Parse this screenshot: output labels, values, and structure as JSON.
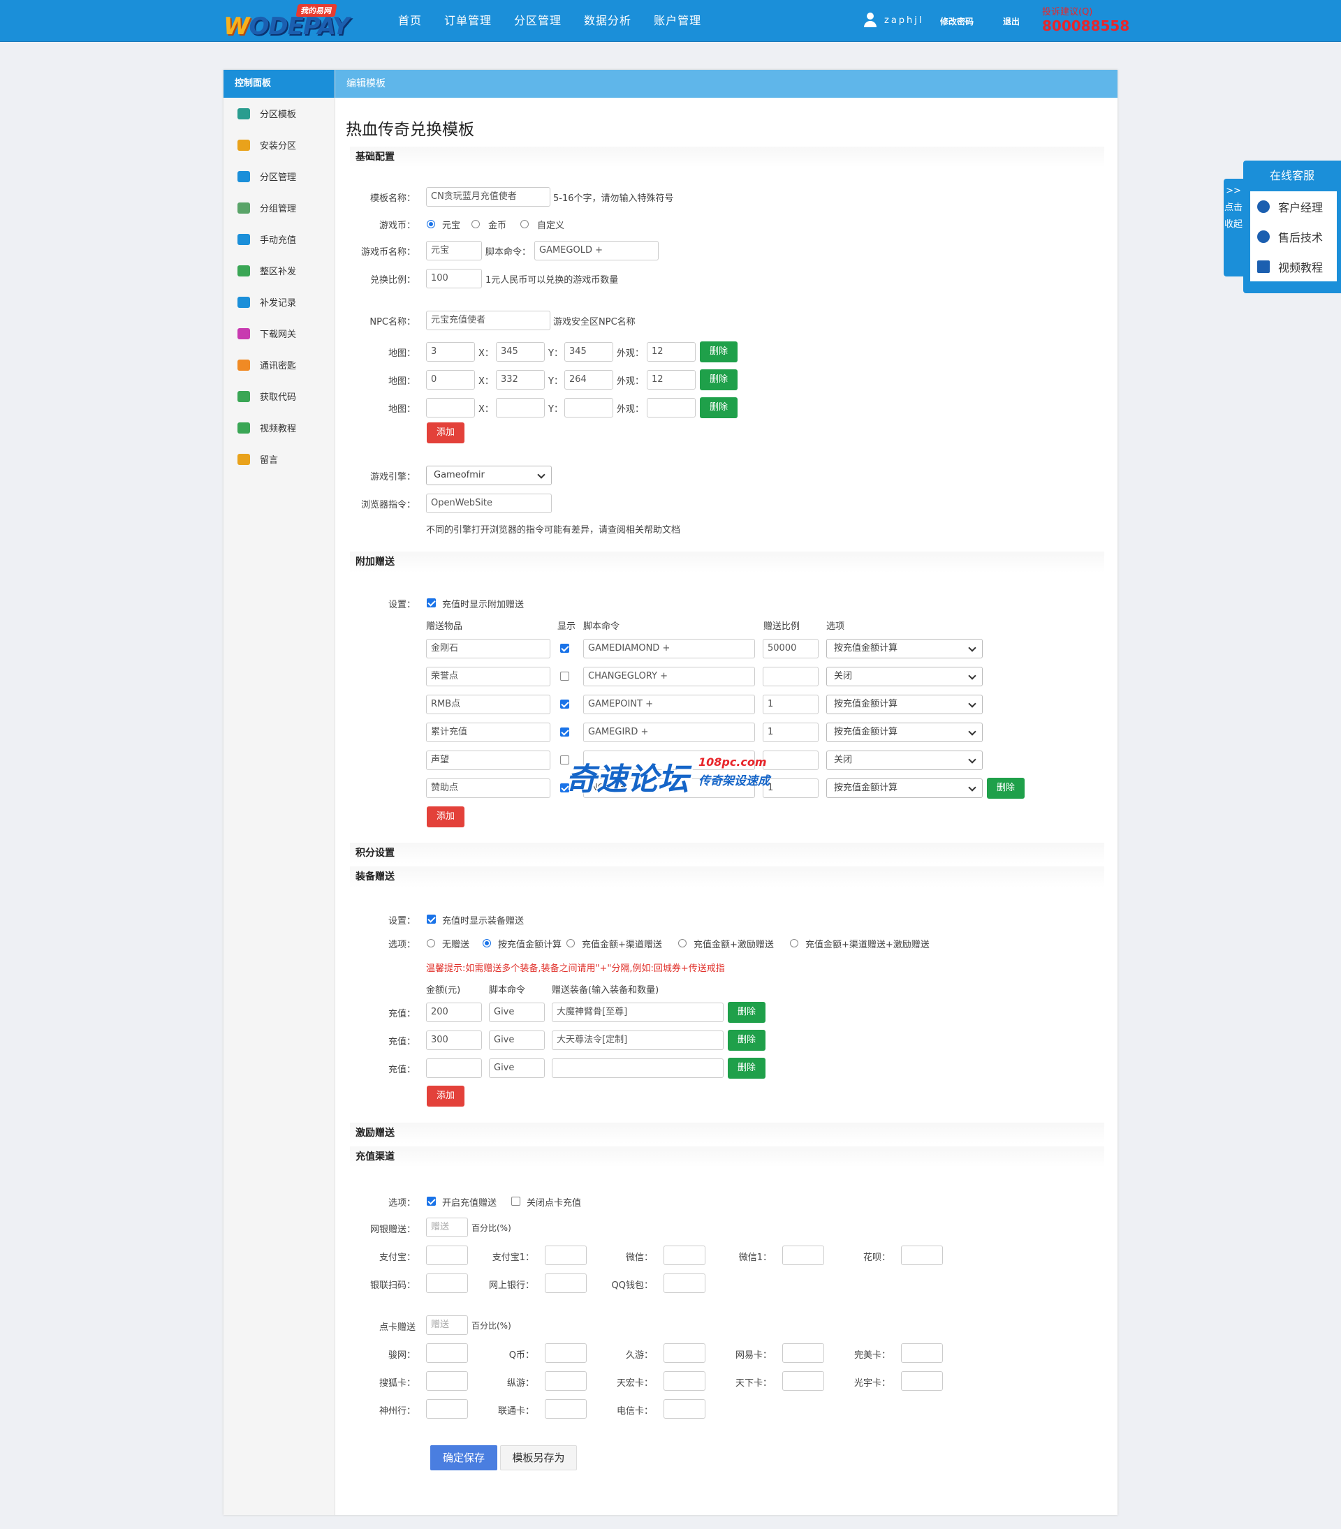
{
  "header": {
    "logo_tag": "我的易网",
    "logo_text_a": "W",
    "logo_text_b": "ODEPAY",
    "nav": [
      "首页",
      "订单管理",
      "分区管理",
      "数据分析",
      "账户管理"
    ],
    "username": "zaphjl",
    "change_pwd": "修改密码",
    "logout": "退出",
    "hotline_label": "投诉建议(Q)",
    "hotline_number": "800088558"
  },
  "sidebar": {
    "title": "控制面板",
    "items": [
      "分区模板",
      "安装分区",
      "分区管理",
      "分组管理",
      "手动充值",
      "整区补发",
      "补发记录",
      "下载网关",
      "通讯密匙",
      "获取代码",
      "视频教程",
      "留言"
    ],
    "icon_colors": [
      "#2a9d8f",
      "#e9a21b",
      "#1b8fd9",
      "#5aa469",
      "#1b8fd9",
      "#3aa655",
      "#1b8fd9",
      "#c83ab0",
      "#f08a24",
      "#3aa655",
      "#3aa655",
      "#e9a21b"
    ]
  },
  "main": {
    "header": "编辑模板",
    "title": "热血传奇兑换模板"
  },
  "basic": {
    "section": "基础配置",
    "name_label": "模板名称：",
    "name_value": "CN贪玩蓝月充值使者",
    "name_hint": "5-16个字，请勿输入特殊符号",
    "currency_label": "游戏币：",
    "currency_options": [
      "元宝",
      "金币",
      "自定义"
    ],
    "currency_name_label": "游戏币名称：",
    "currency_name_value": "元宝",
    "script_label": "脚本命令：",
    "script_value": "GAMEGOLD +",
    "ratio_label": "兑换比例：",
    "ratio_value": "100",
    "ratio_hint": "1元人民币可以兑换的游戏币数量",
    "npc_label": "NPC名称：",
    "npc_value": "元宝充值使者",
    "npc_hint": "游戏安全区NPC名称",
    "map_label": "地图：",
    "x_label": "X：",
    "y_label": "Y：",
    "look_label": "外观：",
    "maps": [
      {
        "map": "3",
        "x": "345",
        "y": "345",
        "look": "12"
      },
      {
        "map": "0",
        "x": "332",
        "y": "264",
        "look": "12"
      },
      {
        "map": "",
        "x": "",
        "y": "",
        "look": ""
      }
    ],
    "delete": "删除",
    "add": "添加",
    "engine_label": "游戏引擎：",
    "engine_value": "Gameofmir",
    "browser_label": "浏览器指令：",
    "browser_value": "OpenWebSite",
    "browser_hint": "不同的引擎打开浏览器的指令可能有差异，请查阅相关帮助文档"
  },
  "extra": {
    "section": "附加赠送",
    "setting_label": "设置：",
    "setting_text": "充值时显示附加赠送",
    "headers": [
      "赠送物品",
      "显示",
      "脚本命令",
      "赠送比例",
      "选项"
    ],
    "rows": [
      {
        "item": "金刚石",
        "show": true,
        "cmd": "GAMEDIAMOND +",
        "ratio": "50000",
        "opt": "按充值金额计算"
      },
      {
        "item": "荣誉点",
        "show": false,
        "cmd": "CHANGEGLORY +",
        "ratio": "",
        "opt": "关闭"
      },
      {
        "item": "RMB点",
        "show": true,
        "cmd": "GAMEPOINT +",
        "ratio": "1",
        "opt": "按充值金额计算"
      },
      {
        "item": "累计充值",
        "show": true,
        "cmd": "GAMEGIRD +",
        "ratio": "1",
        "opt": "按充值金额计算"
      },
      {
        "item": "声望",
        "show": false,
        "cmd": "",
        "ratio": "",
        "opt": "关闭"
      },
      {
        "item": "赞助点",
        "show": true,
        "cmd": "INC U43",
        "ratio": "1",
        "opt": "按充值金额计算"
      }
    ],
    "delete": "删除",
    "add": "添加"
  },
  "points": {
    "section": "积分设置"
  },
  "equip": {
    "section": "装备赠送",
    "setting_label": "设置：",
    "setting_text": "充值时显示装备赠送",
    "option_label": "选项：",
    "options": [
      "无赠送",
      "按充值金额计算",
      "充值金额+渠道赠送",
      "充值金额+激励赠送",
      "充值金额+渠道赠送+激励赠送"
    ],
    "warning": "温馨提示:如需赠送多个装备,装备之间请用\"+\"分隔,例如:回城券+传送戒指",
    "headers": [
      "金额(元)",
      "脚本命令",
      "赠送装备(输入装备和数量)"
    ],
    "charge_label": "充值：",
    "rows": [
      {
        "amount": "200",
        "cmd": "Give",
        "equip": "大魔神臂骨[至尊]"
      },
      {
        "amount": "300",
        "cmd": "Give",
        "equip": "大天尊法令[定制]"
      },
      {
        "amount": "",
        "cmd": "Give",
        "equip": ""
      }
    ],
    "delete": "删除",
    "add": "添加"
  },
  "incentive": {
    "section": "激励赠送"
  },
  "channel": {
    "section": "充值渠道",
    "option_label": "选项：",
    "opt1": "开启充值赠送",
    "opt2": "关闭点卡充值",
    "bank_label": "网银赠送：",
    "bank_placeholder": "赠送",
    "percent": "百分比(%)",
    "row1": [
      "支付宝：",
      "支付宝1：",
      "微信：",
      "微信1：",
      "花呗："
    ],
    "row2": [
      "银联扫码：",
      "网上银行：",
      "QQ钱包："
    ],
    "card_label": "点卡赠送",
    "card_placeholder": "赠送",
    "row3": [
      "骏网：",
      "Q币：",
      "久游：",
      "网易卡：",
      "完美卡："
    ],
    "row4": [
      "搜狐卡：",
      "纵游：",
      "天宏卡：",
      "天下卡：",
      "光宇卡："
    ],
    "row5": [
      "神州行：",
      "联通卡：",
      "电信卡："
    ]
  },
  "actions": {
    "save": "确定保存",
    "save_as": "模板另存为"
  },
  "service": {
    "title": "在线客服",
    "tab_text": ">>点击收起",
    "items": [
      "客户经理",
      "售后技术",
      "视频教程"
    ]
  },
  "watermark": {
    "main": "奇速论坛",
    "url": "108pc.com",
    "sub": "传奇架设速成"
  }
}
